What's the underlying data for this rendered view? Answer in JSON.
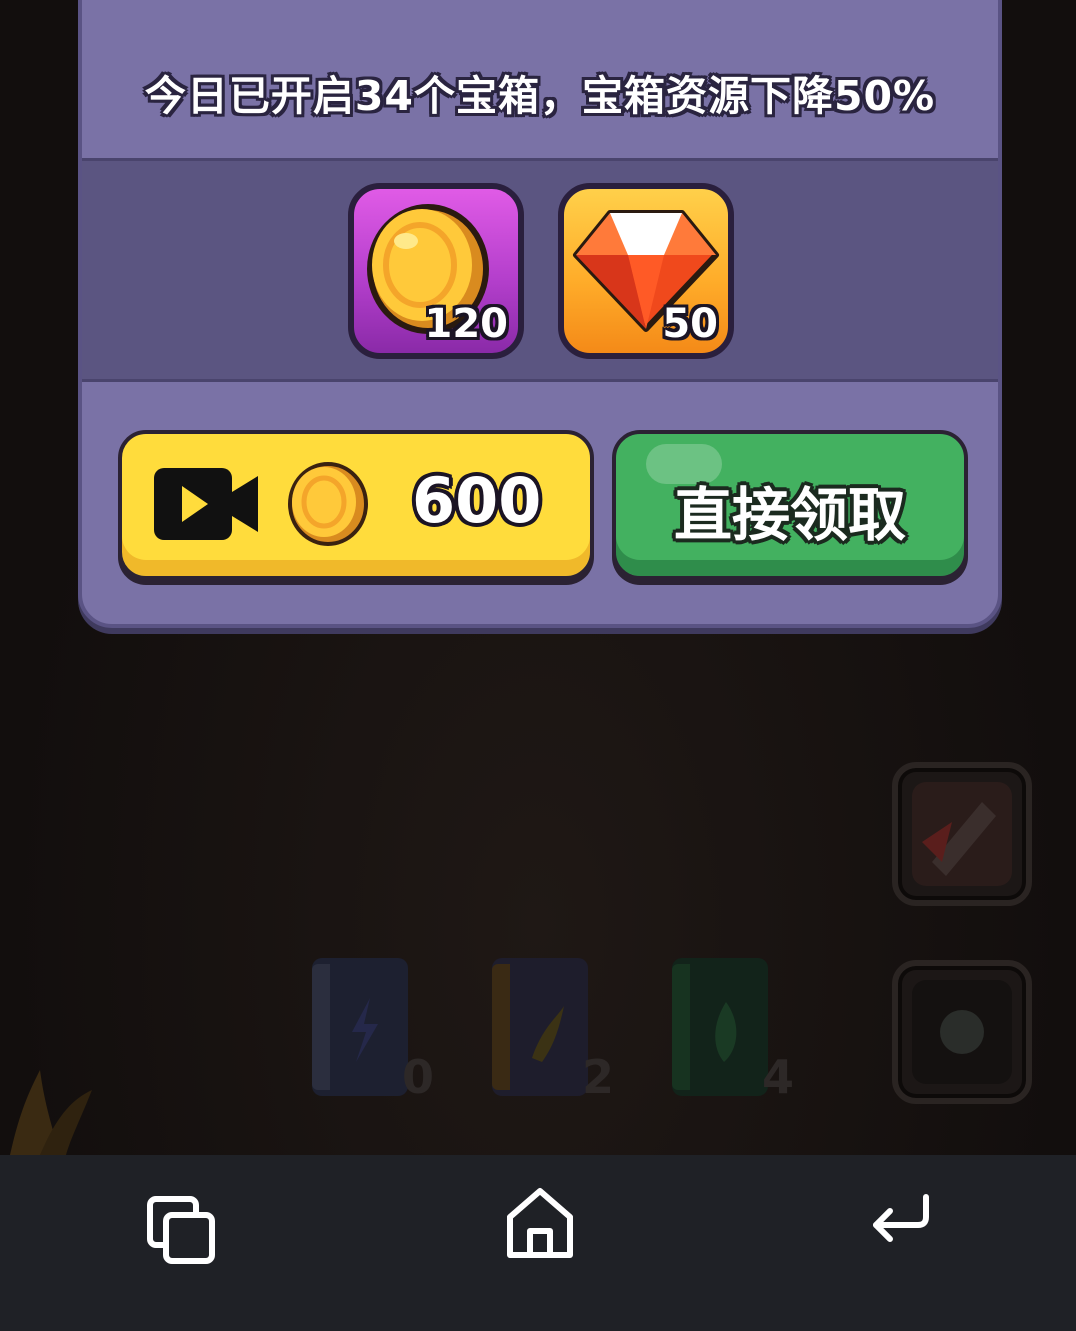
{
  "popup": {
    "notice": "今日已开启34个宝箱，宝箱资源下降50%",
    "rewards": [
      {
        "icon": "coin-icon",
        "amount": "120",
        "tile_color": "#c04ad6"
      },
      {
        "icon": "ruby-gem-icon",
        "amount": "50",
        "tile_color": "#ffb22e"
      }
    ],
    "ad_button": {
      "video_icon": "video-camera-icon",
      "coin_icon": "coin-icon",
      "price": "600",
      "color": "#ffdc3c"
    },
    "claim_button": {
      "label": "直接领取",
      "color": "#43b160"
    }
  },
  "background": {
    "book_counts": [
      "0",
      "2",
      "4"
    ],
    "side_buttons": [
      "skill-icon",
      "orb-icon"
    ]
  },
  "navbar": {
    "buttons": [
      "recent-apps-icon",
      "home-icon",
      "back-icon"
    ]
  },
  "colors": {
    "popup_bg": "#7a72a6",
    "band_bg": "#5b5581",
    "navbar_bg": "#1f2126"
  }
}
